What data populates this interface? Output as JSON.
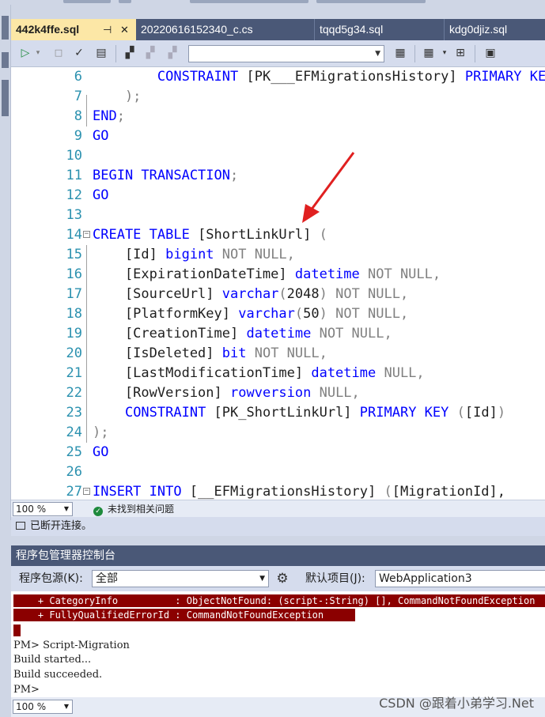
{
  "tabs": [
    {
      "label": "442k4ffe.sql",
      "active": true,
      "pin": "⊣",
      "close": "✕"
    },
    {
      "label": "20220616152340_c.cs",
      "active": false
    },
    {
      "label": "tqqd5g34.sql",
      "active": false
    },
    {
      "label": "kdg0djiz.sql",
      "active": false
    }
  ],
  "toolbar": {
    "icons": [
      "play-icon",
      "stop-icon",
      "check-icon",
      "parse-icon",
      "connect-icon",
      "disconnect-icon",
      "change-connection-icon",
      "database-icon",
      "results-grid-icon",
      "plan-icon",
      "properties-icon"
    ],
    "database_combo_value": ""
  },
  "editor": {
    "lines": [
      {
        "n": "6",
        "fold": "",
        "parts": [
          [
            "",
            "        "
          ],
          [
            "kw",
            "CONSTRAINT"
          ],
          [
            "",
            " [PK___EFMigrationsHistory] "
          ],
          [
            "kw",
            "PRIMARY KEY"
          ]
        ]
      },
      {
        "n": "7",
        "fold": "",
        "parts": [
          [
            "gy",
            "    );"
          ]
        ]
      },
      {
        "n": "8",
        "fold": "",
        "parts": [
          [
            "kw",
            "END"
          ],
          [
            "gy",
            ";"
          ]
        ]
      },
      {
        "n": "9",
        "fold": "",
        "parts": [
          [
            "kw",
            "GO"
          ]
        ]
      },
      {
        "n": "10",
        "fold": "",
        "parts": []
      },
      {
        "n": "11",
        "fold": "",
        "parts": [
          [
            "kw",
            "BEGIN TRANSACTION"
          ],
          [
            "gy",
            ";"
          ]
        ]
      },
      {
        "n": "12",
        "fold": "",
        "parts": [
          [
            "kw",
            "GO"
          ]
        ]
      },
      {
        "n": "13",
        "fold": "",
        "parts": []
      },
      {
        "n": "14",
        "fold": "⊟",
        "parts": [
          [
            "kw",
            "CREATE TABLE"
          ],
          [
            "",
            " [ShortLinkUrl] "
          ],
          [
            "gy",
            "("
          ]
        ]
      },
      {
        "n": "15",
        "fold": "",
        "parts": [
          [
            "",
            "    [Id] "
          ],
          [
            "ty",
            "bigint"
          ],
          [
            "gy",
            " NOT NULL,"
          ]
        ]
      },
      {
        "n": "16",
        "fold": "",
        "parts": [
          [
            "",
            "    [ExpirationDateTime] "
          ],
          [
            "ty",
            "datetime"
          ],
          [
            "gy",
            " NOT NULL,"
          ]
        ]
      },
      {
        "n": "17",
        "fold": "",
        "parts": [
          [
            "",
            "    [SourceUrl] "
          ],
          [
            "ty",
            "varchar"
          ],
          [
            "gy",
            "("
          ],
          [
            "",
            "2048"
          ],
          [
            "gy",
            ") NOT NULL,"
          ]
        ]
      },
      {
        "n": "18",
        "fold": "",
        "parts": [
          [
            "",
            "    [PlatformKey] "
          ],
          [
            "ty",
            "varchar"
          ],
          [
            "gy",
            "("
          ],
          [
            "",
            "50"
          ],
          [
            "gy",
            ") NOT NULL,"
          ]
        ]
      },
      {
        "n": "19",
        "fold": "",
        "parts": [
          [
            "",
            "    [CreationTime] "
          ],
          [
            "ty",
            "datetime"
          ],
          [
            "gy",
            " NOT NULL,"
          ]
        ]
      },
      {
        "n": "20",
        "fold": "",
        "parts": [
          [
            "",
            "    [IsDeleted] "
          ],
          [
            "ty",
            "bit"
          ],
          [
            "gy",
            " NOT NULL,"
          ]
        ]
      },
      {
        "n": "21",
        "fold": "",
        "parts": [
          [
            "",
            "    [LastModificationTime] "
          ],
          [
            "ty",
            "datetime"
          ],
          [
            "gy",
            " NULL,"
          ]
        ]
      },
      {
        "n": "22",
        "fold": "",
        "parts": [
          [
            "",
            "    [RowVersion] "
          ],
          [
            "ty",
            "rowversion"
          ],
          [
            "gy",
            " NULL,"
          ]
        ]
      },
      {
        "n": "23",
        "fold": "",
        "parts": [
          [
            "",
            "    "
          ],
          [
            "kw",
            "CONSTRAINT"
          ],
          [
            "",
            " [PK_ShortLinkUrl] "
          ],
          [
            "kw",
            "PRIMARY KEY"
          ],
          [
            "gy",
            " ("
          ],
          [
            "",
            "[Id]"
          ],
          [
            "gy",
            ")"
          ]
        ]
      },
      {
        "n": "24",
        "fold": "",
        "parts": [
          [
            "gy",
            ");"
          ]
        ]
      },
      {
        "n": "25",
        "fold": "",
        "parts": [
          [
            "kw",
            "GO"
          ]
        ]
      },
      {
        "n": "26",
        "fold": "",
        "parts": []
      },
      {
        "n": "27",
        "fold": "⊟",
        "parts": [
          [
            "kw",
            "INSERT INTO"
          ],
          [
            "",
            " [__EFMigrationsHistory] "
          ],
          [
            "gy",
            "("
          ],
          [
            "",
            "[MigrationId],"
          ]
        ]
      }
    ]
  },
  "editor_status": {
    "zoom": "100 %",
    "issues": "未找到相关问题"
  },
  "connection_status": "已断开连接。",
  "pm_console": {
    "title": "程序包管理器控制台",
    "source_label": "程序包源(K):",
    "source_value": "全部",
    "default_project_label": "默认项目(J):",
    "default_project_value": "WebApplication3",
    "error_lines": [
      "    + CategoryInfo          : ObjectNotFound: (script-:String) [], CommandNotFoundException",
      "    + FullyQualifiedErrorId : CommandNotFoundException "
    ],
    "output_lines": [
      "PM> Script-Migration",
      "Build started...",
      "Build succeeded.",
      "PM>"
    ],
    "zoom": "100 %"
  },
  "watermark": "CSDN @跟着小弟学习.Net",
  "colors": {
    "accent_tab": "#fce7a6",
    "title_bar": "#4a5877",
    "keyword": "#0000ff",
    "line_number": "#2b91af",
    "error_bg": "#8b0000",
    "annotation_arrow": "#e02020"
  }
}
